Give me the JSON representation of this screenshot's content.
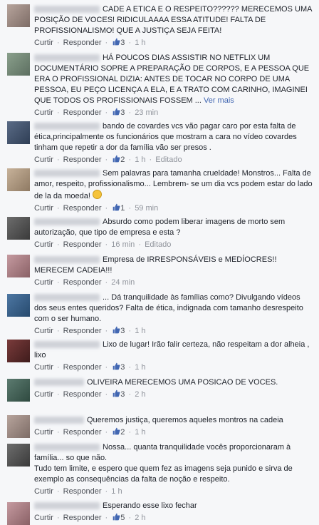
{
  "actions": {
    "like": "Curtir",
    "reply": "Responder",
    "sep": " · ",
    "edited": "Editado"
  },
  "comments": [
    {
      "text": "CADE A ETICA E O RESPEITO?????? MERECEMOS UMA POSIÇÃO DE VOCES! RIDICULAAAA ESSA ATITUDE! FALTA DE PROFISSIONALISMO! QUE A JUSTIÇA SEJA FEITA!",
      "likes": "3",
      "time": "1 h"
    },
    {
      "text": "HÁ POUCOS DIAS ASSISTIR NO NETFLIX UM DOCUMENTÁRIO SOPRE A PREPARAÇÃO DE CORPOS, E A PESSOA QUE ERA O PROFISSIONAL DIZIA: ANTES DE TOCAR NO CORPO DE UMA PESSOA, EU PEÇO LICENÇA A ELA, E A TRATO COM CARINHO, IMAGINEI QUE TODOS OS PROFISSIONAIS FOSSEM ...",
      "more": "Ver mais",
      "likes": "3",
      "time": "23 min"
    },
    {
      "text": "bando de covardes vcs vão pagar caro por esta falta de ética,principalmente os funcionários que mostram a cara no vídeo covardes tinham que repetir a dor da família vão ser presos .",
      "likes": "2",
      "time": "1 h",
      "edited": true
    },
    {
      "text": "Sem palavras para tamanha crueldade! Monstros... Falta de amor, respeito, profissionalismo... Lembrem- se um dia vcs podem estar do lado de la da moeda!",
      "emoji": true,
      "likes": "1",
      "time": "59 min"
    },
    {
      "text": "Absurdo como podem liberar imagens de morto sem autorização, que tipo de empresa e esta ?",
      "time": "16 min",
      "edited": true
    },
    {
      "text": "Empresa de IRRESPONSÁVEIS e MEDÍOCRES!! MERECEM CADEIA!!!",
      "time": "24 min"
    },
    {
      "text": "... Dá tranquilidade às famílias como? Divulgando vídeos dos seus entes queridos? Falta de ética, indignada com tamanho desrespeito com o ser humano.",
      "likes": "3",
      "time": "1 h"
    },
    {
      "text": "Lixo de lugar! Irão falir certeza, não respeitam a dor alheia , lixo",
      "likes": "3",
      "time": "1 h"
    },
    {
      "text": "OLIVEIRA MERECEMOS UMA POSICAO DE VOCES.",
      "likes": "3",
      "time": "2 h"
    },
    {
      "text": "Queremos justiça, queremos aqueles montros na cadeia",
      "likes": "2",
      "time": "1 h"
    },
    {
      "text": "Nossa... quanta tranquilidade vocês proporcionaram à família... so que não.\nTudo tem limite, e espero que quem fez as imagens seja punido e sirva de exemplo as consequências da falta de noção e respeito.",
      "time": "1 h"
    },
    {
      "text": "Esperando esse lixo fechar",
      "likes": "5",
      "time": "2 h"
    }
  ]
}
